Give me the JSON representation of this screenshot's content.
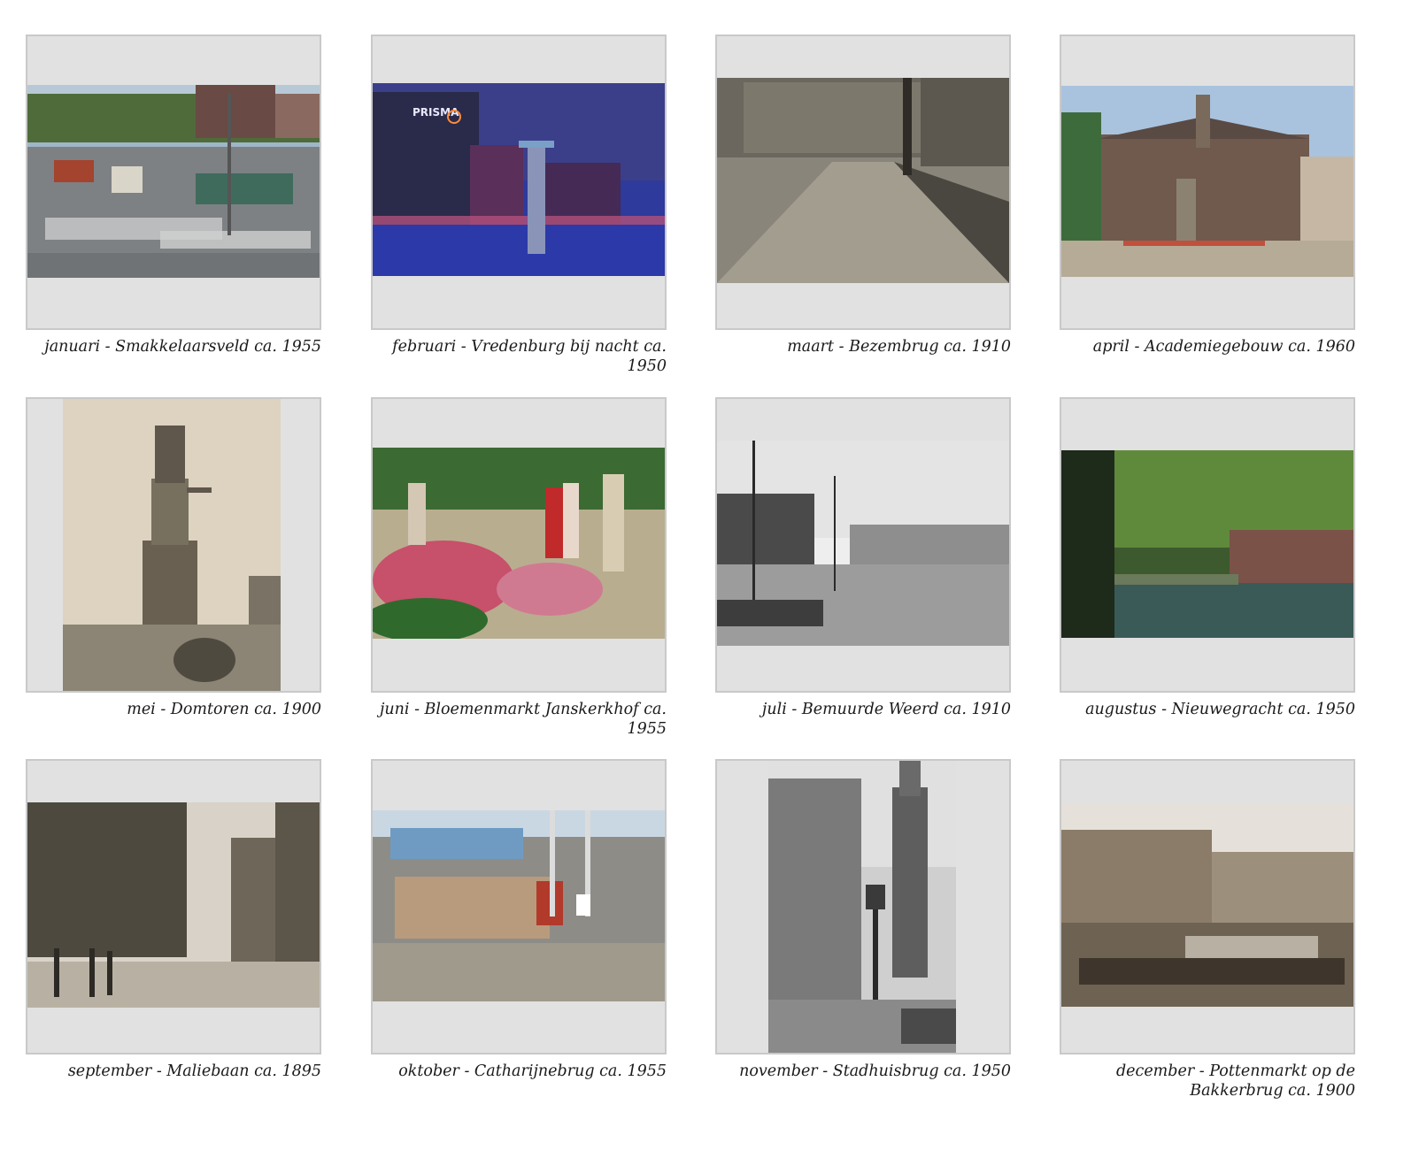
{
  "captions": [
    {
      "month": "januari",
      "text": "januari - Smakkelaarsveld ca. 1955"
    },
    {
      "month": "februari",
      "text": "februari - Vredenburg bij nacht ca. 1950"
    },
    {
      "month": "maart",
      "text": "maart - Bezembrug ca. 1910"
    },
    {
      "month": "april",
      "text": "april - Academiegebouw ca. 1960"
    },
    {
      "month": "mei",
      "text": "mei - Domtoren ca. 1900"
    },
    {
      "month": "juni",
      "text": "juni - Bloemenmarkt Janskerkhof ca. 1955"
    },
    {
      "month": "juli",
      "text": "juli - Bemuurde Weerd ca. 1910"
    },
    {
      "month": "augustus",
      "text": "augustus - Nieuwegracht ca. 1950"
    },
    {
      "month": "september",
      "text": "september - Maliebaan ca. 1895"
    },
    {
      "month": "oktober",
      "text": "oktober - Catharijnebrug ca. 1955"
    },
    {
      "month": "november",
      "text": "november - Stadhuisbrug ca. 1950"
    },
    {
      "month": "december",
      "text": "december - Pottenmarkt op de Bakkerbrug ca. 1900"
    }
  ],
  "sign_text": "PRISMA"
}
